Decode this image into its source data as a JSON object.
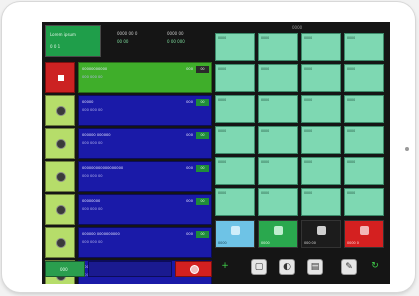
{
  "device": {
    "camera": "camera-dot"
  },
  "top": {
    "button": {
      "line1": "Lorem ipsum",
      "line2": "0 0 1"
    },
    "info1": "0000 00 0",
    "info2": "0000 00",
    "info3": "00 00",
    "info4": "0 00 000"
  },
  "rows": [
    {
      "name": "00000000000",
      "sub": "000 000 00",
      "num": "000",
      "tag": "00",
      "icon": "stop-icon"
    },
    {
      "name": "00000",
      "sub": "000 000 00",
      "num": "000",
      "tag": "00",
      "icon": "knob-icon"
    },
    {
      "name": "000000 000000",
      "sub": "000 000 00",
      "num": "000",
      "tag": "00",
      "icon": "knob-icon"
    },
    {
      "name": "000000000000000000",
      "sub": "000 000 00",
      "num": "000",
      "tag": "00",
      "icon": "knob-icon"
    },
    {
      "name": "00000000",
      "sub": "000 000 00",
      "num": "000",
      "tag": "00",
      "icon": "knob-icon"
    },
    {
      "name": "000000 0000000000",
      "sub": "000 000 00",
      "num": "000",
      "tag": "00",
      "icon": "knob-icon"
    },
    {
      "name": "00000000000000000000",
      "sub": "000 000 00",
      "num": "000",
      "tag": "00",
      "icon": "knob-icon"
    }
  ],
  "bottom_left": {
    "green_label": "000",
    "red_icon": "record-icon"
  },
  "grid": {
    "label": "0000",
    "cells": [
      [
        "0000",
        "0000",
        "0000",
        "0000"
      ],
      [
        "0000",
        "0000",
        "0000",
        "0000"
      ],
      [
        "0000",
        "0000",
        "0000",
        "0000"
      ],
      [
        "0000",
        "0000",
        "0000",
        "0000"
      ],
      [
        "0000",
        "0000",
        "0000",
        "0000"
      ],
      [
        "0000",
        "0000",
        "0000",
        "0000"
      ]
    ]
  },
  "actions": [
    {
      "label": "0000",
      "icon": "tile-icon"
    },
    {
      "label": "0000",
      "icon": "tile-icon"
    },
    {
      "label": "000 00",
      "icon": "dark-tile-icon"
    },
    {
      "label": "0000 0",
      "icon": "alert-icon"
    }
  ],
  "toolbar": [
    "plus-icon",
    "square-icon",
    "palette-icon",
    "document-icon",
    "pencil-icon",
    "refresh-icon"
  ],
  "colors": {
    "screen_bg": "#151515",
    "row_bar": "#1a1aa8",
    "row_first_bar": "#3fae2a",
    "grid_cell": "#7ed8b2",
    "alert": "#d42020"
  }
}
